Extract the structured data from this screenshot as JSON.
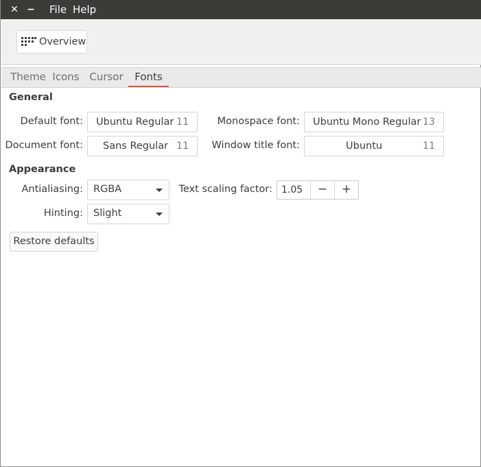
{
  "titlebar": {
    "close_glyph": "✕",
    "minimize_glyph": "−",
    "menus": [
      "File",
      "Help"
    ]
  },
  "toolbar": {
    "overview_label": "Overview",
    "overview_icon": "grid-icon"
  },
  "tabs": [
    {
      "label": "Theme",
      "active": false
    },
    {
      "label": "Icons",
      "active": false
    },
    {
      "label": "Cursor",
      "active": false
    },
    {
      "label": "Fonts",
      "active": true
    }
  ],
  "accent_color": "#e0574a",
  "general": {
    "title": "General",
    "default_font": {
      "label": "Default font:",
      "name": "Ubuntu Regular",
      "size": "11"
    },
    "document_font": {
      "label": "Document font:",
      "name": "Sans Regular",
      "size": "11"
    },
    "monospace_font": {
      "label": "Monospace font:",
      "name": "Ubuntu Mono Regular",
      "size": "13"
    },
    "window_title_font": {
      "label": "Window title font:",
      "name": "Ubuntu",
      "size": "11"
    }
  },
  "appearance": {
    "title": "Appearance",
    "antialiasing": {
      "label": "Antialiasing:",
      "value": "RGBA"
    },
    "hinting": {
      "label": "Hinting:",
      "value": "Slight"
    },
    "text_scaling": {
      "label": "Text scaling factor:",
      "value": "1.05",
      "minus": "−",
      "plus": "+"
    }
  },
  "restore_defaults_label": "Restore defaults"
}
